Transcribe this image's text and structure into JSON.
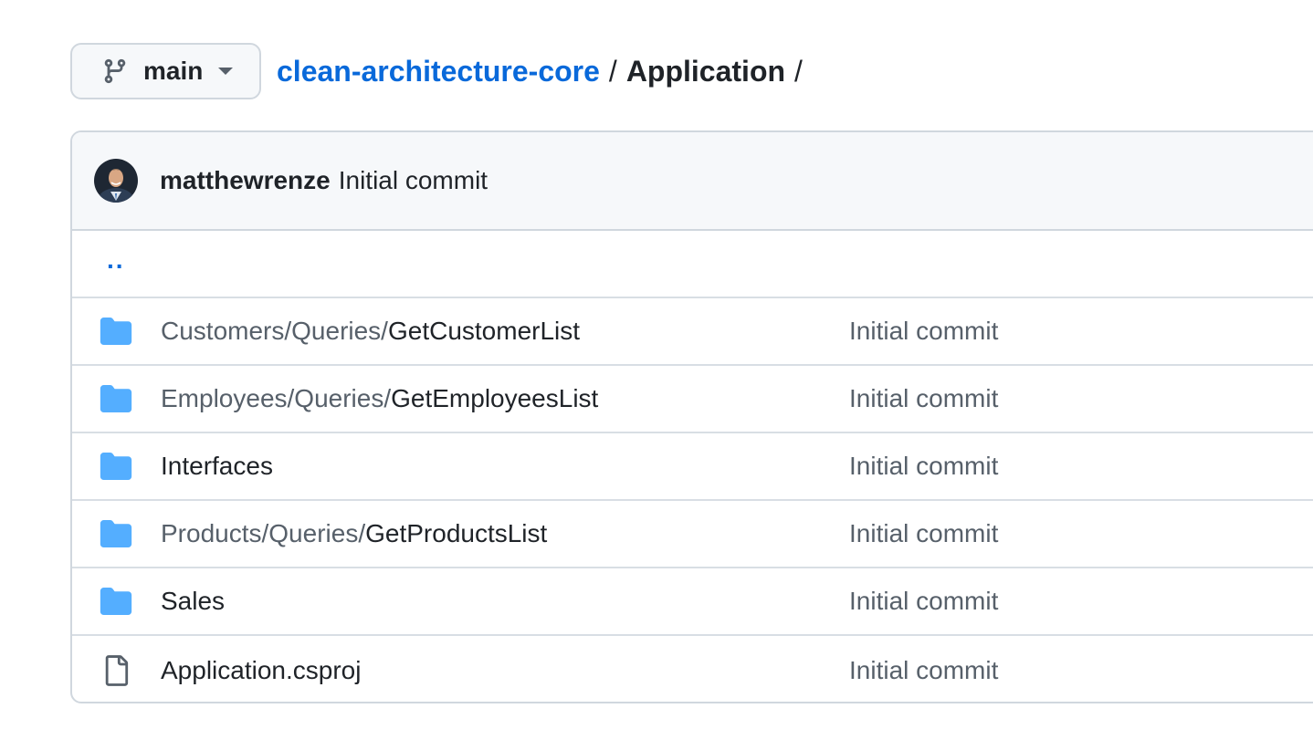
{
  "branch": {
    "label": "main",
    "icon": "git-branch-icon"
  },
  "breadcrumb": {
    "repo": "clean-architecture-core",
    "separator": "/",
    "current": "Application",
    "trailing_separator": "/"
  },
  "latest_commit": {
    "author": "matthewrenze",
    "message": "Initial commit"
  },
  "parent_link": "..",
  "colors": {
    "link": "#0969da",
    "folder": "#54aeff",
    "muted": "#57606a",
    "border": "#d0d7de"
  },
  "files": [
    {
      "type": "folder",
      "icon": "folder-icon",
      "prefix": "Customers/Queries/",
      "name": "GetCustomerList",
      "commit": "Initial commit"
    },
    {
      "type": "folder",
      "icon": "folder-icon",
      "prefix": "Employees/Queries/",
      "name": "GetEmployeesList",
      "commit": "Initial commit"
    },
    {
      "type": "folder",
      "icon": "folder-icon",
      "prefix": "",
      "name": "Interfaces",
      "commit": "Initial commit"
    },
    {
      "type": "folder",
      "icon": "folder-icon",
      "prefix": "Products/Queries/",
      "name": "GetProductsList",
      "commit": "Initial commit"
    },
    {
      "type": "folder",
      "icon": "folder-icon",
      "prefix": "",
      "name": "Sales",
      "commit": "Initial commit"
    },
    {
      "type": "file",
      "icon": "file-icon",
      "prefix": "",
      "name": "Application.csproj",
      "commit": "Initial commit"
    }
  ]
}
